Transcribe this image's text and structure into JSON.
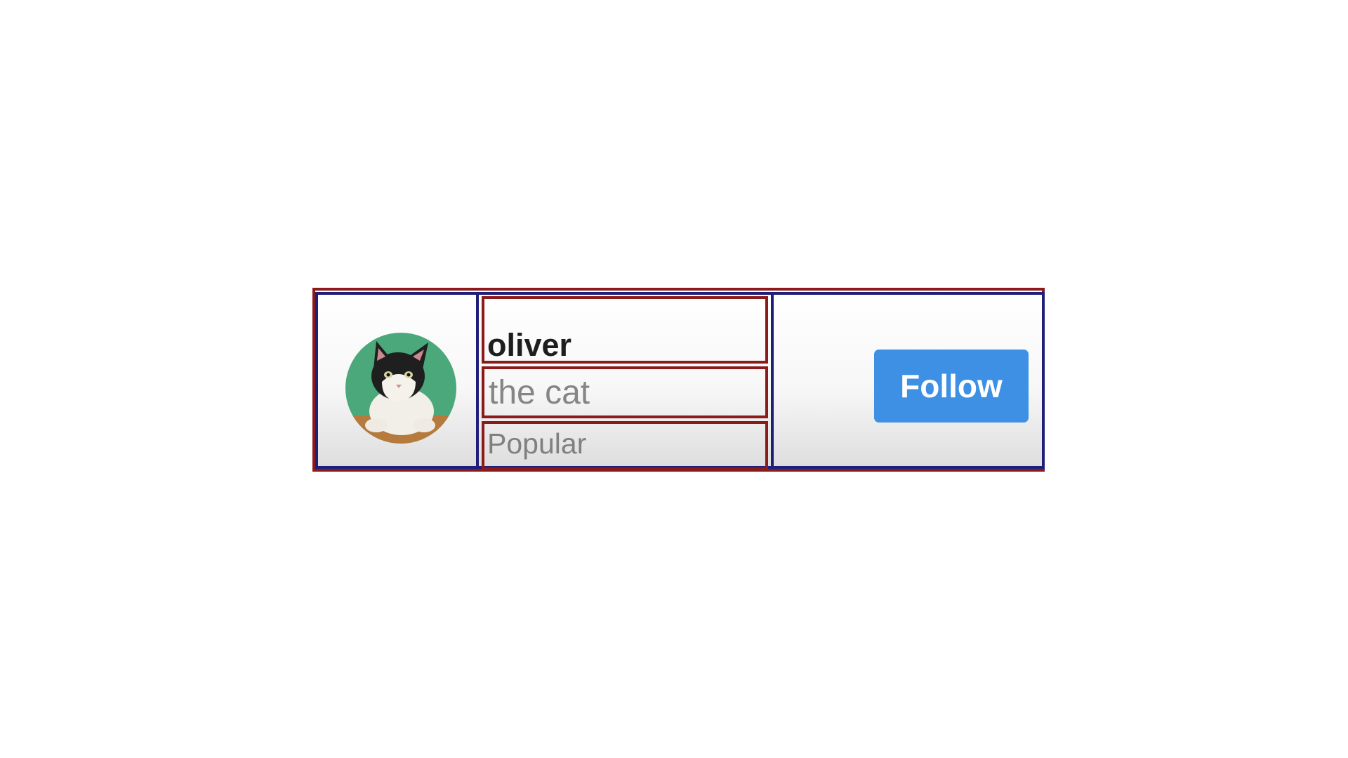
{
  "profile": {
    "name": "oliver",
    "subtitle": "the cat",
    "status": "Popular",
    "avatar_icon": "cat-avatar"
  },
  "actions": {
    "follow_label": "Follow"
  },
  "colors": {
    "follow_button": "#3e90e4",
    "outline_red": "#8b1a1a",
    "outline_blue": "#1f1f7a",
    "avatar_bg": "#4aa87a"
  }
}
